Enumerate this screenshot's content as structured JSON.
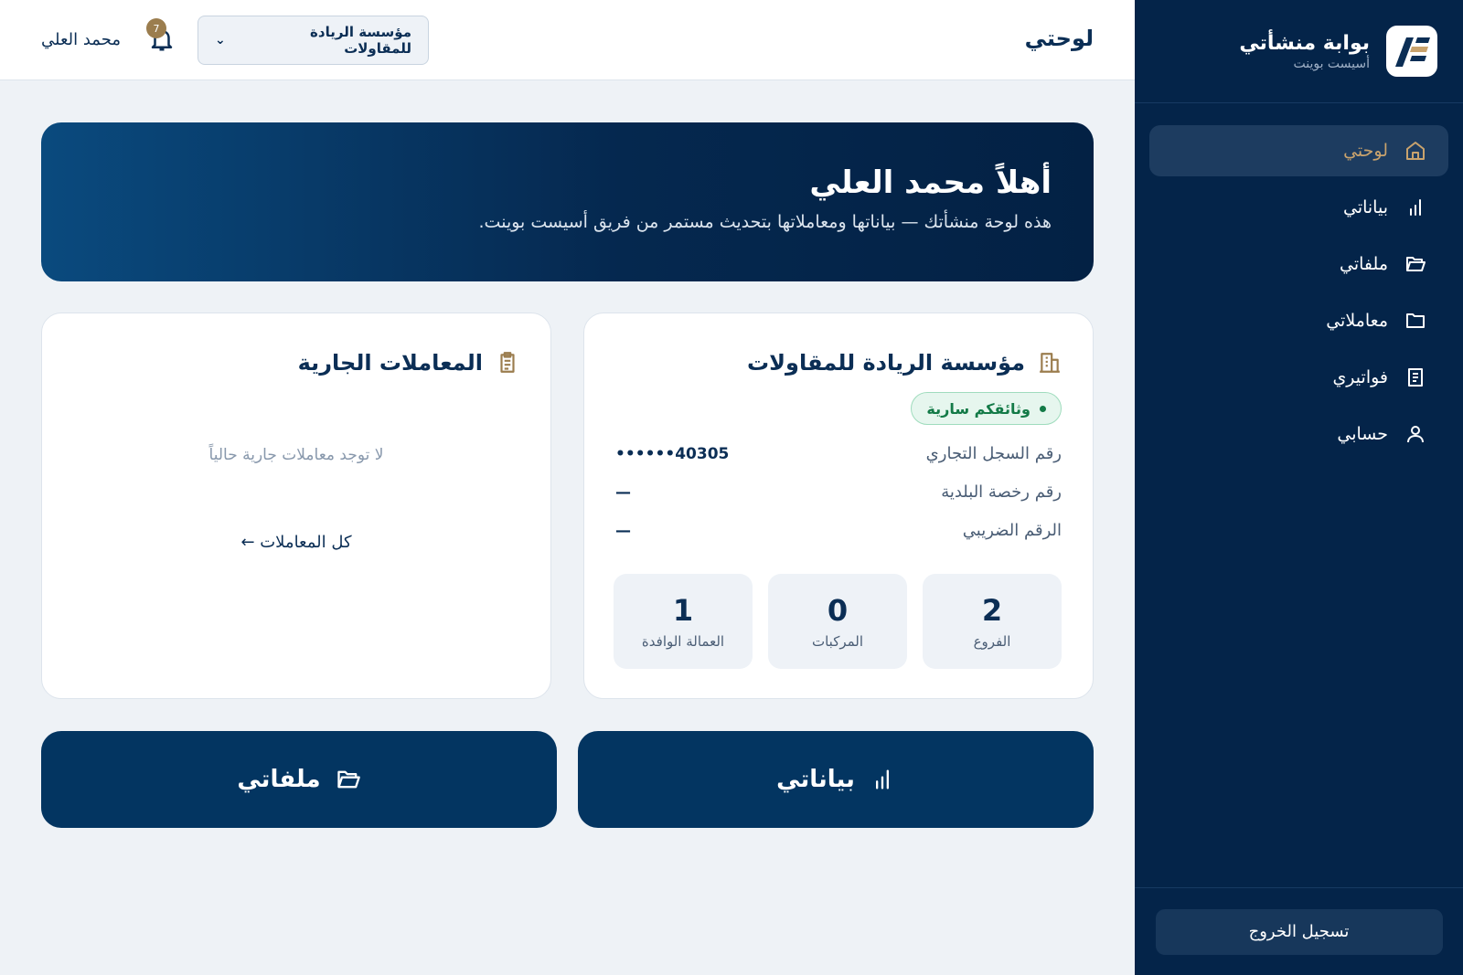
{
  "brand": {
    "title": "بوابة منشأتي",
    "subtitle": "أسيست بوينت"
  },
  "nav": [
    {
      "label": "لوحتي",
      "icon": "home-icon",
      "active": true
    },
    {
      "label": "بياناتي",
      "icon": "bar-chart-icon"
    },
    {
      "label": "ملفاتي",
      "icon": "folder-open-icon"
    },
    {
      "label": "معاملاتي",
      "icon": "folder-icon"
    },
    {
      "label": "فواتيري",
      "icon": "receipt-icon"
    },
    {
      "label": "حسابي",
      "icon": "user-icon"
    }
  ],
  "logout_label": "تسجيل الخروج",
  "header": {
    "page_title": "لوحتي",
    "org_select_value": "مؤسسة الريادة للمقاولات",
    "notification_count": "7",
    "user_name": "محمد العلي"
  },
  "hero": {
    "title": "أهلاً محمد العلي",
    "subtitle": "هذه لوحة منشأتك — بياناتها ومعاملاتها بتحديث مستمر من فريق أسيست بوينت."
  },
  "org_card": {
    "title": "مؤسسة الريادة للمقاولات",
    "status": "وثائقكم سارية",
    "rows": [
      {
        "label": "رقم السجل التجاري",
        "value": "40305••••••"
      },
      {
        "label": "رقم رخصة البلدية",
        "value": "—"
      },
      {
        "label": "الرقم الضريبي",
        "value": "—"
      }
    ],
    "stats": [
      {
        "value": "2",
        "label": "الفروع"
      },
      {
        "value": "0",
        "label": "المركبات"
      },
      {
        "value": "1",
        "label": "العمالة الوافدة"
      }
    ]
  },
  "tx_card": {
    "title": "المعاملات الجارية",
    "empty": "لا توجد معاملات جارية حالياً",
    "link": "كل المعاملات ←"
  },
  "buttons": {
    "data": "بياناتي",
    "files": "ملفاتي"
  },
  "colors": {
    "navy": "#042449",
    "accent": "#c9a36d",
    "success": "#137a47"
  }
}
